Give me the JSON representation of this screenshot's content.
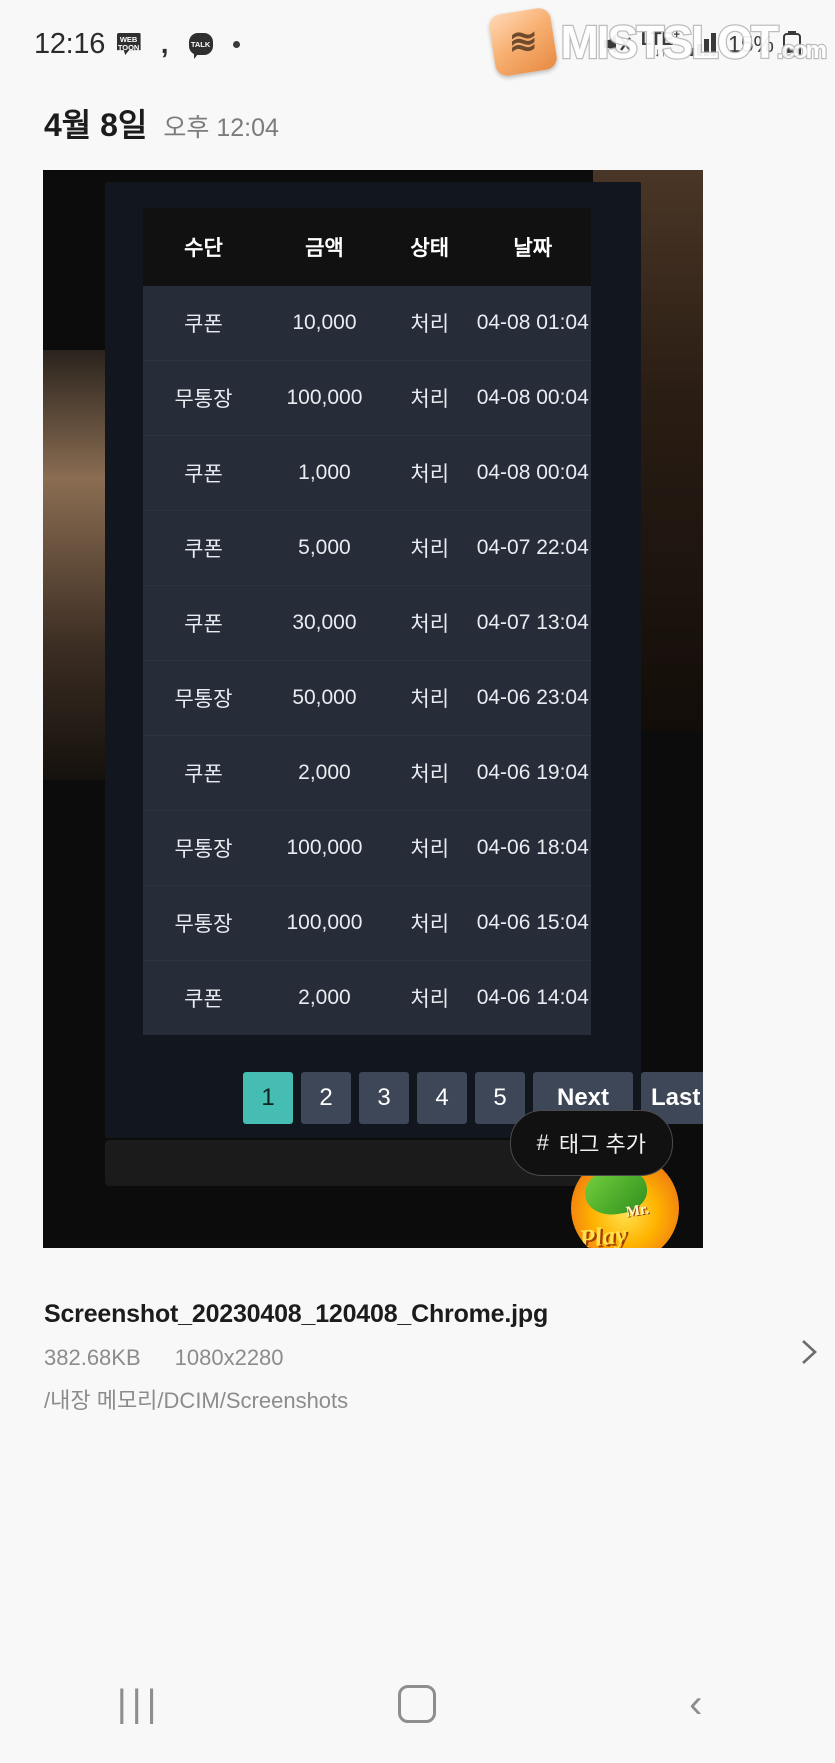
{
  "statusbar": {
    "clock": "12:16",
    "icons": [
      "webtoon-icon",
      "comma-icon",
      "talk-icon",
      "dot-icon"
    ],
    "webtoon_label": "WEB TOON",
    "talk_label": "TALK",
    "network": "LTE",
    "network_plus": "+",
    "battery": "15%"
  },
  "watermark": {
    "text": "MISTSLOT",
    "suffix": ".com"
  },
  "date_header": {
    "date": "4월 8일",
    "time": "오후 12:04"
  },
  "table": {
    "headers": [
      "수단",
      "금액",
      "상태",
      "날짜"
    ],
    "rows": [
      {
        "method": "쿠폰",
        "amount": "10,000",
        "status": "처리",
        "date": "04-08 01:04"
      },
      {
        "method": "무통장",
        "amount": "100,000",
        "status": "처리",
        "date": "04-08 00:04"
      },
      {
        "method": "쿠폰",
        "amount": "1,000",
        "status": "처리",
        "date": "04-08 00:04"
      },
      {
        "method": "쿠폰",
        "amount": "5,000",
        "status": "처리",
        "date": "04-07 22:04"
      },
      {
        "method": "쿠폰",
        "amount": "30,000",
        "status": "처리",
        "date": "04-07 13:04"
      },
      {
        "method": "무통장",
        "amount": "50,000",
        "status": "처리",
        "date": "04-06 23:04"
      },
      {
        "method": "쿠폰",
        "amount": "2,000",
        "status": "처리",
        "date": "04-06 19:04"
      },
      {
        "method": "무통장",
        "amount": "100,000",
        "status": "처리",
        "date": "04-06 18:04"
      },
      {
        "method": "무통장",
        "amount": "100,000",
        "status": "처리",
        "date": "04-06 15:04"
      },
      {
        "method": "쿠폰",
        "amount": "2,000",
        "status": "처리",
        "date": "04-06 14:04"
      }
    ]
  },
  "pagination": {
    "pages": [
      "1",
      "2",
      "3",
      "4",
      "5"
    ],
    "active": "1",
    "next_label": "Next",
    "last_label": "Last",
    "active_color": "#45bdb2",
    "button_color": "#3e4757"
  },
  "tag_button": {
    "hash": "#",
    "label": "태그 추가"
  },
  "thumbnail": {
    "brand_small": "Mr.",
    "brand_big": "Play"
  },
  "file_info": {
    "name": "Screenshot_20230408_120408_Chrome.jpg",
    "size": "382.68KB",
    "dimensions": "1080x2280",
    "path": "/내장 메모리/DCIM/Screenshots"
  },
  "navbar": {
    "recents": "|||",
    "home": "home-icon",
    "back": "‹"
  }
}
